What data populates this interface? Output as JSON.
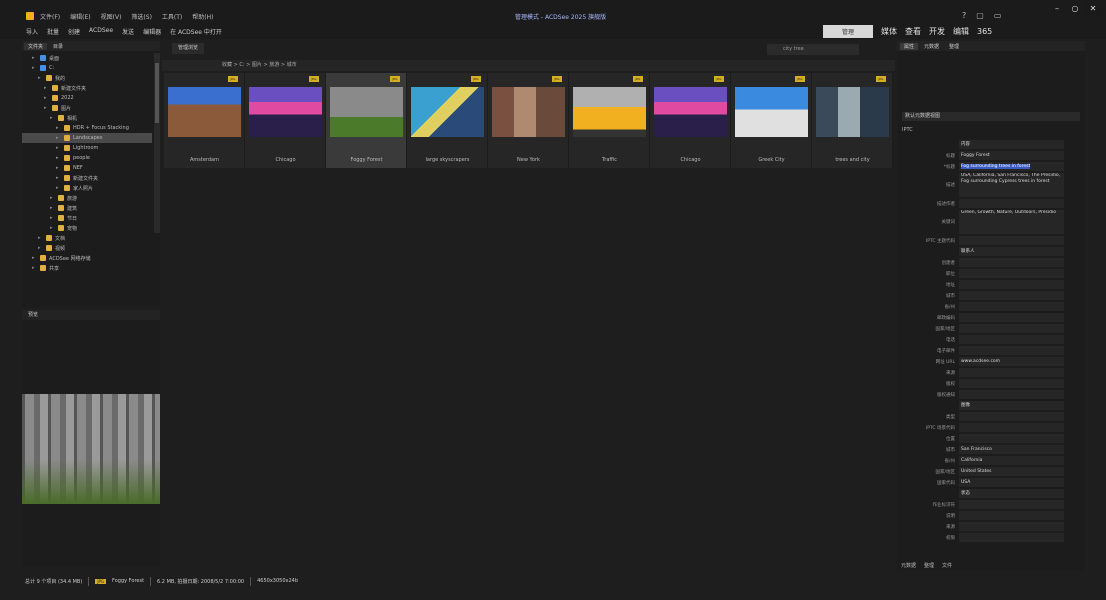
{
  "app": {
    "title": "管理模式 - ACDSee 2025 旗舰版",
    "menu": [
      "文件(F)",
      "编辑(E)",
      "视图(V)",
      "筛选(S)",
      "工具(T)",
      "帮助(H)"
    ],
    "toolbar": [
      "导入",
      "批量",
      "创建",
      "ACDSee",
      "发送",
      "编辑器",
      "在 ACDSee 中打开"
    ],
    "modes": [
      "管理",
      "媒体",
      "查看",
      "开发",
      "编辑",
      "365"
    ]
  },
  "left_panel": {
    "tabs": [
      "文件夹",
      "目录"
    ],
    "tree": [
      {
        "label": "桌面",
        "level": 1,
        "blue": true
      },
      {
        "label": "C:",
        "level": 1,
        "blue": true
      },
      {
        "label": "我的",
        "level": 2
      },
      {
        "label": "新建文件夹",
        "level": 3
      },
      {
        "label": "2022",
        "level": 3
      },
      {
        "label": "图片",
        "level": 3
      },
      {
        "label": "相机",
        "level": 4
      },
      {
        "label": "HDR + Focus Stacking",
        "level": 5
      },
      {
        "label": "Landscapes",
        "level": 5,
        "selected": true
      },
      {
        "label": "Lightroom",
        "level": 5
      },
      {
        "label": "people",
        "level": 5
      },
      {
        "label": "NEF",
        "level": 5
      },
      {
        "label": "新建文件夹",
        "level": 5
      },
      {
        "label": "家人照片",
        "level": 5
      },
      {
        "label": "旅游",
        "level": 4
      },
      {
        "label": "建筑",
        "level": 4
      },
      {
        "label": "节日",
        "level": 4
      },
      {
        "label": "宠物",
        "level": 4
      },
      {
        "label": "文档",
        "level": 2
      },
      {
        "label": "视频",
        "level": 2
      },
      {
        "label": "ACDSee 网络存储",
        "level": 1
      },
      {
        "label": "共享",
        "level": 1
      }
    ],
    "preview_tab": "预览"
  },
  "browser": {
    "tab": "管理浏览",
    "search_placeholder": "city tree",
    "address": "收藏 > C: > 图片 > 旅游 > 城市",
    "thumbs": [
      {
        "caption": "Amsterdam",
        "badge": "JPG"
      },
      {
        "caption": "Chicago",
        "badge": "JPG"
      },
      {
        "caption": "Foggy Forest",
        "badge": "JPG",
        "selected": true
      },
      {
        "caption": "large skyscrapers",
        "badge": "JPG"
      },
      {
        "caption": "New York",
        "badge": "JPG"
      },
      {
        "caption": "Traffic",
        "badge": "JPG"
      },
      {
        "caption": "Chicago",
        "badge": "JPG"
      },
      {
        "caption": "Greek City",
        "badge": "JPG"
      },
      {
        "caption": "trees and city",
        "badge": "JPG"
      }
    ]
  },
  "properties": {
    "tabs": [
      "属性",
      "元数据",
      "整理"
    ],
    "dropdown": "默认元数据视图",
    "section": "IPTC",
    "fields": [
      {
        "label": "",
        "value": "内容"
      },
      {
        "label": "标题",
        "value": "Foggy Forest"
      },
      {
        "label": "*标题",
        "value": "Fog surrounding ",
        "hl": "trees in forest"
      },
      {
        "label": "描述",
        "value": "USA, California, San Francisco, The Presidio, Fog surrounding Cypress trees in forest",
        "tall": true
      },
      {
        "label": "描述作者",
        "value": ""
      },
      {
        "label": "关键词",
        "value": "Green, Growth, Nature, Outdoors, Presidio",
        "tall": true
      },
      {
        "label": "IPTC 主题代码",
        "value": ""
      },
      {
        "label": "",
        "value": "联系人"
      },
      {
        "label": "创建者",
        "value": ""
      },
      {
        "label": "职位",
        "value": ""
      },
      {
        "label": "地址",
        "value": ""
      },
      {
        "label": "城市",
        "value": ""
      },
      {
        "label": "省/州",
        "value": ""
      },
      {
        "label": "邮政编码",
        "value": ""
      },
      {
        "label": "国家/地区",
        "value": ""
      },
      {
        "label": "电话",
        "value": ""
      },
      {
        "label": "电子邮件",
        "value": ""
      },
      {
        "label": "网址 URL",
        "value": "www.acdsee.com"
      },
      {
        "label": "来源",
        "value": ""
      },
      {
        "label": "版权",
        "value": ""
      },
      {
        "label": "版权通知",
        "value": ""
      },
      {
        "label": "",
        "value": "图像"
      },
      {
        "label": "类型",
        "value": ""
      },
      {
        "label": "IPTC 场景代码",
        "value": ""
      },
      {
        "label": "位置",
        "value": ""
      },
      {
        "label": "城市",
        "value": "San Francisco"
      },
      {
        "label": "省/州",
        "value": "California"
      },
      {
        "label": "国家/地区",
        "value": "United States"
      },
      {
        "label": "国家代码",
        "value": "USA"
      },
      {
        "label": "",
        "value": "状态"
      },
      {
        "label": "作业标识符",
        "value": ""
      },
      {
        "label": "说明",
        "value": ""
      },
      {
        "label": "来源",
        "value": ""
      },
      {
        "label": "权限",
        "value": ""
      }
    ],
    "bottom_tabs": [
      "元数据",
      "整理",
      "文件"
    ]
  },
  "status": {
    "total": "总计 9 个项目 (34.4 MB)",
    "badge": "JPG",
    "file": "Foggy Forest",
    "size": "6.2 MB, 拍摄日期: 2008/5/2 7:00:00",
    "dims": "4650x3050x24b"
  }
}
